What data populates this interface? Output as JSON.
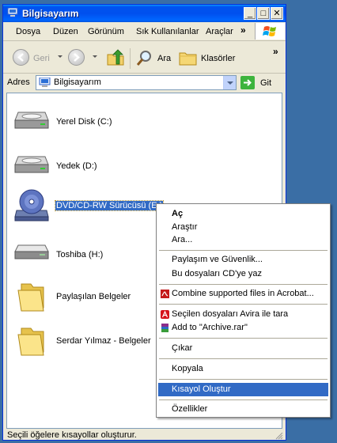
{
  "window": {
    "title": "Bilgisayarım"
  },
  "menubar": {
    "items": [
      "Dosya",
      "Düzen",
      "Görünüm",
      "Sık Kullanılanlar",
      "Araçlar"
    ],
    "overflow": "»"
  },
  "toolbar": {
    "back_label": "Geri",
    "search_label": "Ara",
    "folders_label": "Klasörler",
    "overflow": "»"
  },
  "address": {
    "label": "Adres",
    "value": "Bilgisayarım",
    "go_label": "Git"
  },
  "drives": [
    {
      "label": "Yerel Disk (C:)",
      "icon": "hard-disk-icon"
    },
    {
      "label": "Yedek (D:)",
      "icon": "hard-disk-icon"
    },
    {
      "label": "DVD/CD-RW Sürücüsü (E:)",
      "icon": "dvd-drive-icon",
      "selected": true
    },
    {
      "label": "Toshiba (H:)",
      "icon": "removable-disk-icon"
    },
    {
      "label": "Paylaşılan Belgeler",
      "icon": "folder-icon"
    },
    {
      "label": "Serdar Yılmaz - Belgeler",
      "icon": "folder-icon"
    }
  ],
  "context_menu": {
    "open": "Aç",
    "explore": "Araştır",
    "search": "Ara...",
    "sharing": "Paylaşım ve Güvenlik...",
    "burn": "Bu dosyaları CD'ye yaz",
    "acrobat": "Combine supported files in Acrobat...",
    "avira": "Seçilen dosyaları Avira ile tara",
    "rar": "Add to \"Archive.rar\"",
    "eject": "Çıkar",
    "copy": "Kopyala",
    "shortcut": "Kısayol Oluştur",
    "properties": "Özellikler"
  },
  "status": {
    "text": "Seçili öğelere kısayollar oluşturur."
  },
  "colors": {
    "titlebar": "#0053ee",
    "selection": "#316ac5",
    "desktop": "#3a6ea5"
  }
}
